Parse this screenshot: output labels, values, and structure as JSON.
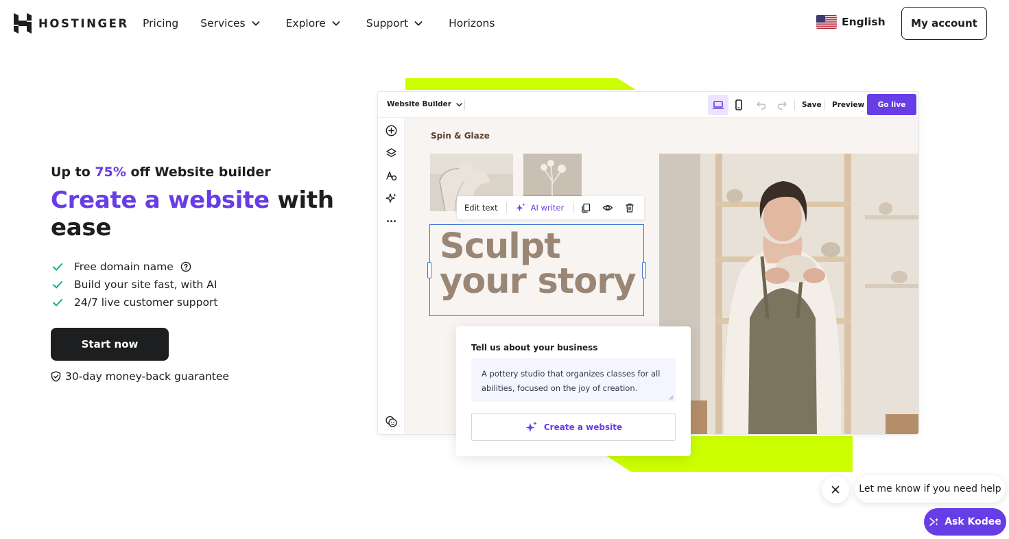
{
  "colors": {
    "brand_purple": "#673de6",
    "lime_accent": "#ccff00",
    "dark": "#1d1e20",
    "check_green": "#00b090"
  },
  "header": {
    "logo_text": "HOSTINGER",
    "nav": [
      {
        "label": "Pricing",
        "dropdown": false
      },
      {
        "label": "Services",
        "dropdown": true
      },
      {
        "label": "Explore",
        "dropdown": true
      },
      {
        "label": "Support",
        "dropdown": true
      },
      {
        "label": "Horizons",
        "dropdown": false
      }
    ],
    "language": "English",
    "account_label": "My account"
  },
  "hero": {
    "promo_prefix": "Up to ",
    "promo_percent": "75%",
    "promo_suffix": " off Website builder",
    "headline_accent": "Create a website",
    "headline_rest": " with ease",
    "features": [
      "Free domain name",
      "Build your site fast, with AI",
      "24/7 live customer support"
    ],
    "cta_label": "Start now",
    "guarantee": "30-day money-back guarantee"
  },
  "builder": {
    "selector_label": "Website Builder",
    "save_label": "Save",
    "preview_label": "Preview",
    "golive_label": "Go live",
    "sidebar_icons": [
      "add-icon",
      "layers-icon",
      "styles-icon",
      "ai-tools-icon",
      "more-icon",
      "help-face-icon"
    ],
    "canvas": {
      "brand_name": "Spin & Glaze",
      "edit_text_label": "Edit text",
      "ai_writer_label": "AI writer",
      "headline_line1": "Sculpt",
      "headline_line2": "your story"
    },
    "prompt": {
      "title": "Tell us about your business",
      "text": "A pottery studio that organizes classes for all abilities, focused on the joy of creation.",
      "button_label": "Create a website"
    }
  },
  "chat": {
    "message": "Let me know if you need help",
    "button_label": "Ask Kodee"
  }
}
